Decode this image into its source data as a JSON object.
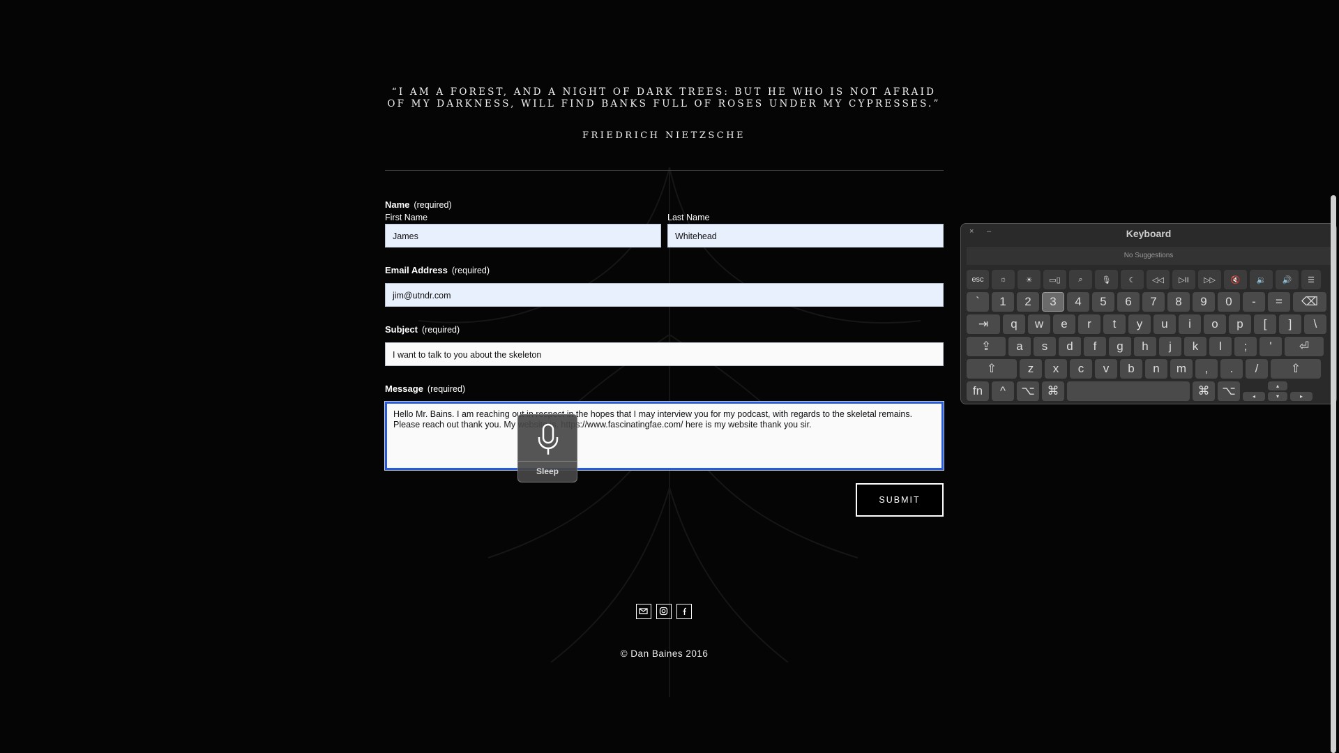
{
  "quote": {
    "text": "“I am a forest, and a night of dark trees: but he who is not afraid of my darkness, will find banks full of roses under my cypresses.”",
    "author": "FRIEDRICH NIETZSCHE"
  },
  "form": {
    "name_label": "Name",
    "required": "(required)",
    "first_name_label": "First Name",
    "last_name_label": "Last Name",
    "first_name_value": "James",
    "last_name_value": "Whitehead",
    "email_label": "Email Address",
    "email_value": "jim@utndr.com",
    "subject_label": "Subject",
    "subject_value": "I want to talk to you about the skeleton",
    "message_label": "Message",
    "message_value": "Hello Mr. Bains. I am reaching out in respect in the hopes that I may interview you for my podcast, with regards to the skeletal remains. Please reach out thank you. My website is. https://www.fascinatingfae.com/ here is my website thank you sir.",
    "submit_label": "SUBMIT"
  },
  "dictation": {
    "status": "Sleep",
    "icon": "microphone-icon"
  },
  "footer": {
    "icons": [
      "email-icon",
      "instagram-icon",
      "facebook-icon"
    ],
    "copyright": "© Dan Baines 2016"
  },
  "keyboard": {
    "title": "Keyboard",
    "suggestions": "No Suggestions",
    "close": "×",
    "minimize": "–",
    "function_row": [
      "esc",
      "☼",
      "☀",
      "▭▯",
      "⌕",
      "🎙",
      "☾",
      "◁◁",
      "▷II",
      "▷▷",
      "🔇",
      "🔉",
      "🔊",
      "☰"
    ],
    "number_row": [
      "`",
      "1",
      "2",
      "3",
      "4",
      "5",
      "6",
      "7",
      "8",
      "9",
      "0",
      "-",
      "=",
      "⌫"
    ],
    "top_row": [
      "⇥",
      "q",
      "w",
      "e",
      "r",
      "t",
      "y",
      "u",
      "i",
      "o",
      "p",
      "[",
      "]",
      "\\"
    ],
    "home_row": [
      "⇪",
      "a",
      "s",
      "d",
      "f",
      "g",
      "h",
      "j",
      "k",
      "l",
      ";",
      "'",
      "⏎"
    ],
    "bottom_row": [
      "⇧",
      "z",
      "x",
      "c",
      "v",
      "b",
      "n",
      "m",
      ",",
      ".",
      "/",
      "⇧"
    ],
    "modifier_row": [
      "fn",
      "^",
      "⌥",
      "⌘",
      "",
      "⌘",
      "⌥"
    ],
    "arrows": [
      "▴",
      "◂",
      "▾",
      "▸"
    ],
    "active_key": "3"
  }
}
